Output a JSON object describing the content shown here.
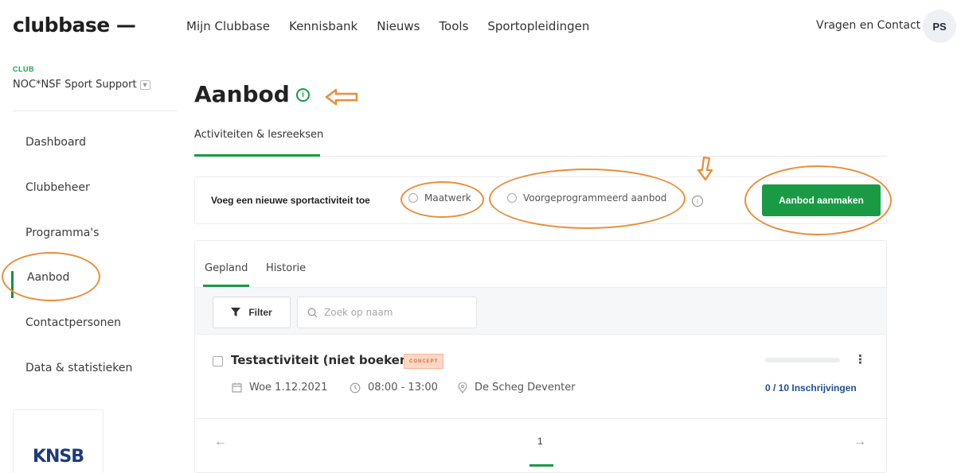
{
  "header": {
    "logo": "clubbase —",
    "nav": [
      "Mijn Clubbase",
      "Kennisbank",
      "Nieuws",
      "Tools",
      "Sportopleidingen"
    ],
    "contact": "Vragen en Contact",
    "avatar_initials": "PS"
  },
  "sidebar": {
    "club_label": "CLUB",
    "club_name": "NOC*NSF Sport Support",
    "items": [
      {
        "label": "Dashboard",
        "active": false
      },
      {
        "label": "Clubbeheer",
        "active": false
      },
      {
        "label": "Programma's",
        "active": false
      },
      {
        "label": "Aanbod",
        "active": true
      },
      {
        "label": "Contactpersonen",
        "active": false
      },
      {
        "label": "Data & statistieken",
        "active": false
      }
    ],
    "partner_logo": "KNSB"
  },
  "main": {
    "title": "Aanbod",
    "tab": "Activiteiten & lesreeksen",
    "add_card": {
      "label": "Voeg een nieuwe sportactiviteit toe",
      "options": [
        "Maatwerk",
        "Voorgeprogrammeerd aanbod"
      ],
      "button": "Aanbod aanmaken"
    },
    "list": {
      "tabs": [
        "Gepland",
        "Historie"
      ],
      "filter_label": "Filter",
      "search_placeholder": "Zoek op naam",
      "rows": [
        {
          "title": "Testactiviteit (niet boeken)",
          "badge": "CONCEPT",
          "date": "Woe 1.12.2021",
          "time": "08:00 - 13:00",
          "location": "De Scheg Deventer",
          "registrations": "0 / 10 Inschrijvingen",
          "registrations_fraction": 0
        }
      ],
      "pagination": {
        "page": "1"
      }
    }
  },
  "colors": {
    "accent": "#1a9a45",
    "annotation": "#ea8e3a",
    "badge_text": "#e0652f",
    "link_blue": "#1f4e97"
  }
}
